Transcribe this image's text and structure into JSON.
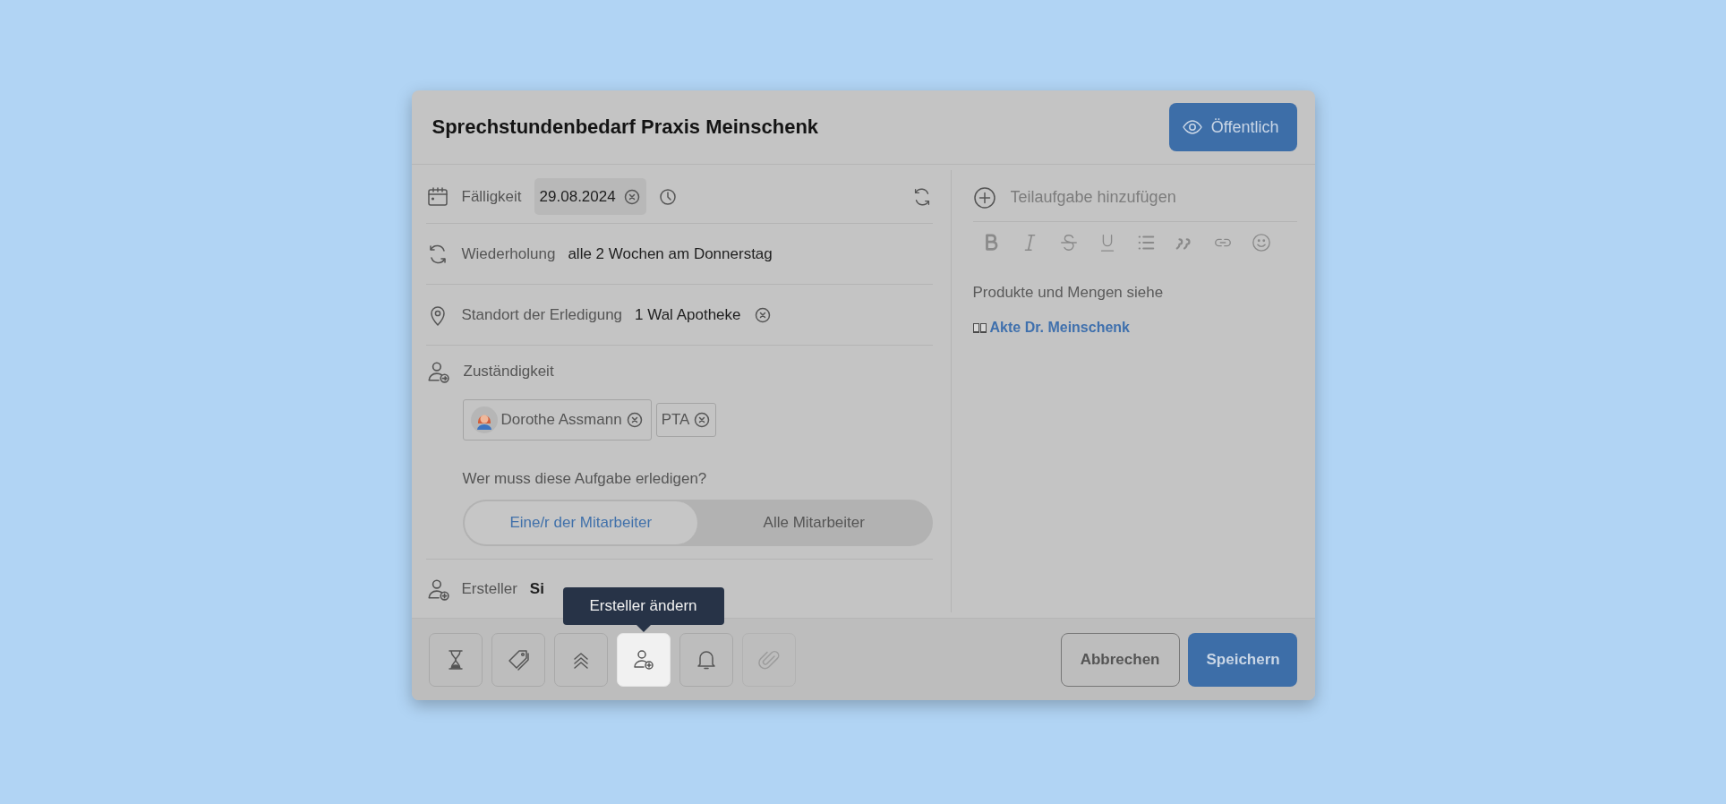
{
  "dialog": {
    "title": "Sprechstundenbedarf Praxis Meinschenk",
    "visibility_button": {
      "label": "Öffentlich"
    }
  },
  "fields": [
    {
      "kind": "date",
      "label": "Fälligkeit",
      "value": "29.08.2024"
    },
    {
      "kind": "recurrence",
      "label": "Wiederholung",
      "value": "alle 2 Wochen am Donnerstag"
    },
    {
      "kind": "location",
      "label": "Standort der Erledigung",
      "value": "1 Wal Apotheke"
    }
  ],
  "responsibility": {
    "label": "Zuständigkeit",
    "assignees": [
      {
        "kind": "person",
        "name": "Dorothe Assmann"
      },
      {
        "kind": "group",
        "name": "PTA"
      }
    ],
    "question": "Wer muss diese Aufgabe erledigen?",
    "options": [
      {
        "label": "Eine/r der Mitarbeiter",
        "selected": true
      },
      {
        "label": "Alle Mitarbeiter",
        "selected": false
      }
    ]
  },
  "creator": {
    "label": "Ersteller",
    "value": "Si"
  },
  "subtask": {
    "placeholder": "Teilaufgabe hinzufügen"
  },
  "editor": {
    "text": "Produkte und Mengen siehe",
    "link": "Akte Dr. Meinschenk"
  },
  "toolbar": [
    {
      "kind": "hourglass",
      "selected": false,
      "disabled": false
    },
    {
      "kind": "tag",
      "selected": false,
      "disabled": false
    },
    {
      "kind": "priority",
      "selected": false,
      "disabled": false
    },
    {
      "kind": "creator",
      "selected": true,
      "disabled": false
    },
    {
      "kind": "bell",
      "selected": false,
      "disabled": false
    },
    {
      "kind": "attachment",
      "selected": false,
      "disabled": true
    }
  ],
  "tooltip": "Ersteller ändern",
  "buttons": [
    {
      "kind": "secondary",
      "label": "Abbrechen"
    },
    {
      "kind": "primary",
      "label": "Speichern"
    }
  ]
}
